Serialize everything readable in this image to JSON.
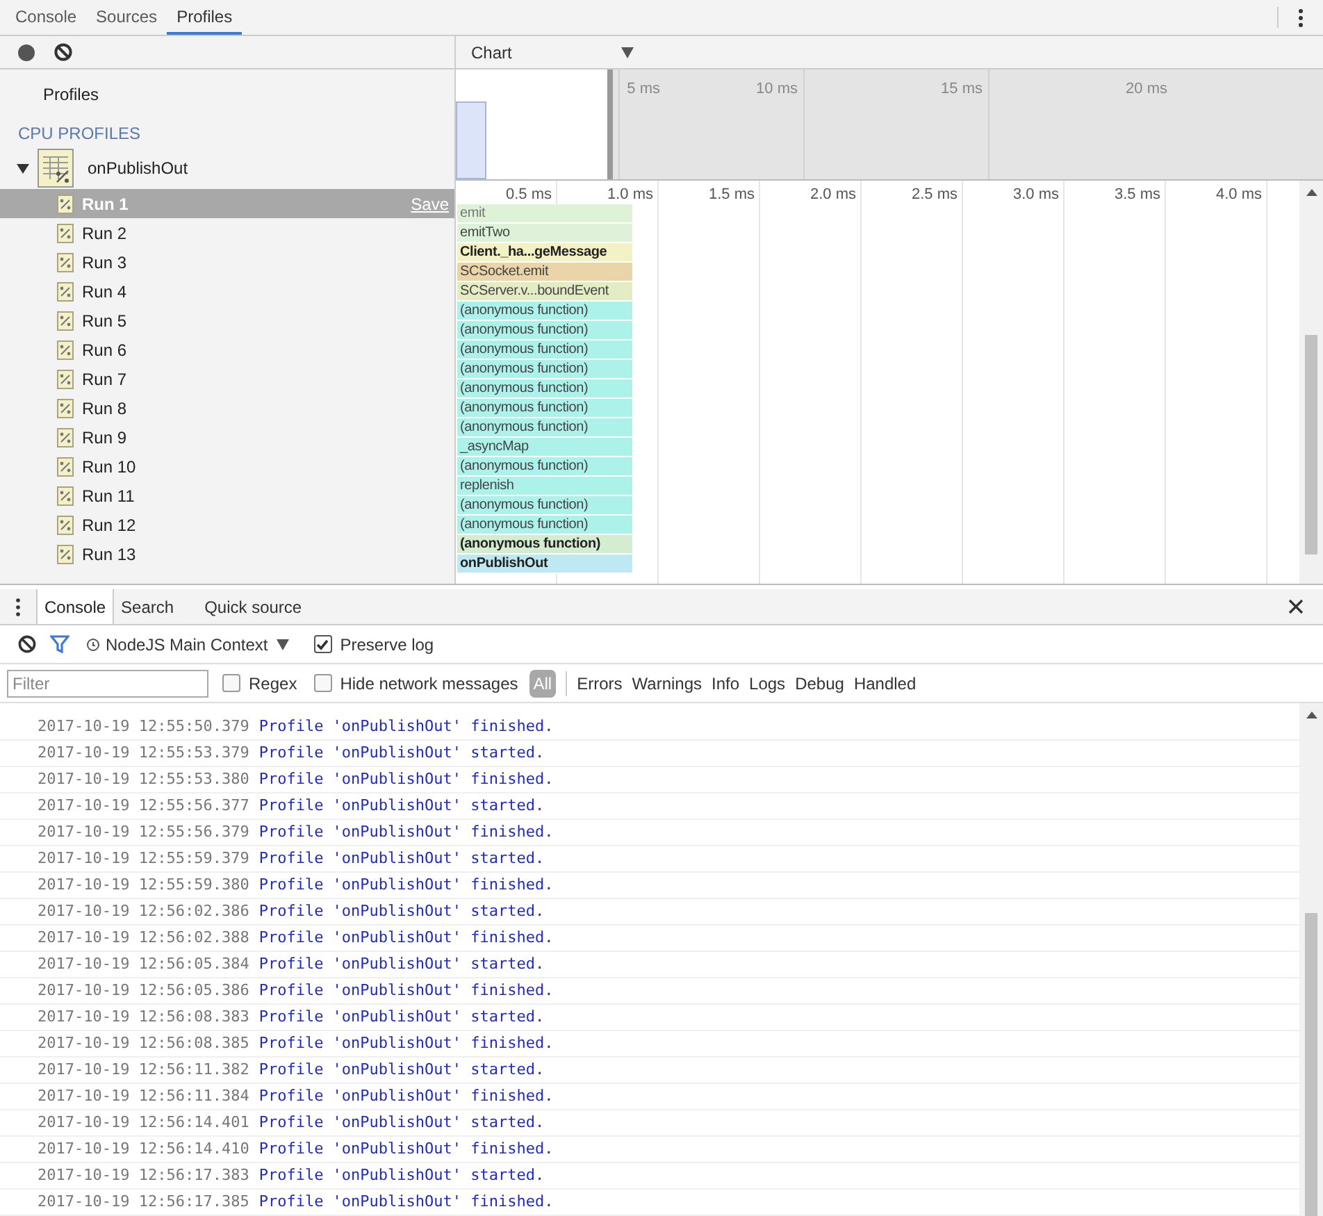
{
  "main_tabs": [
    {
      "label": "Console",
      "selected": false
    },
    {
      "label": "Sources",
      "selected": false
    },
    {
      "label": "Profiles",
      "selected": true
    }
  ],
  "profiles_sidebar": {
    "heading": "Profiles",
    "section": "CPU PROFILES",
    "group": {
      "name": "onPublishOut",
      "expanded": true,
      "children": [
        {
          "label": "Run 1",
          "selected": true,
          "action": "Save"
        },
        {
          "label": "Run 2",
          "selected": false
        },
        {
          "label": "Run 3",
          "selected": false
        },
        {
          "label": "Run 4",
          "selected": false
        },
        {
          "label": "Run 5",
          "selected": false
        },
        {
          "label": "Run 6",
          "selected": false
        },
        {
          "label": "Run 7",
          "selected": false
        },
        {
          "label": "Run 8",
          "selected": false
        },
        {
          "label": "Run 9",
          "selected": false
        },
        {
          "label": "Run 10",
          "selected": false
        },
        {
          "label": "Run 11",
          "selected": false
        },
        {
          "label": "Run 12",
          "selected": false
        },
        {
          "label": "Run 13",
          "selected": false
        }
      ]
    }
  },
  "chart_view": {
    "mode": "Chart",
    "overview_ticks": [
      "5 ms",
      "10 ms",
      "15 ms",
      "20 ms"
    ],
    "ticks": [
      "0.5 ms",
      "1.0 ms",
      "1.5 ms",
      "2.0 ms",
      "2.5 ms",
      "3.0 ms",
      "3.5 ms",
      "4.0 ms"
    ],
    "flame": [
      {
        "label": "emit",
        "color": "#def2d8",
        "bold": false
      },
      {
        "label": "emitTwo",
        "color": "#def2d8",
        "bold": false
      },
      {
        "label": "Client._ha...geMessage",
        "color": "#f2f2c4",
        "bold": true
      },
      {
        "label": "SCSocket.emit",
        "color": "#ead5a8",
        "bold": false
      },
      {
        "label": "SCServer.v...boundEvent",
        "color": "#e4ecc4",
        "bold": false
      },
      {
        "label": "(anonymous function)",
        "color": "#adf2ea",
        "bold": false
      },
      {
        "label": "(anonymous function)",
        "color": "#adf2ea",
        "bold": false
      },
      {
        "label": "(anonymous function)",
        "color": "#adf2ea",
        "bold": false
      },
      {
        "label": "(anonymous function)",
        "color": "#adf2ea",
        "bold": false
      },
      {
        "label": "(anonymous function)",
        "color": "#adf2ea",
        "bold": false
      },
      {
        "label": "(anonymous function)",
        "color": "#adf2ea",
        "bold": false
      },
      {
        "label": "(anonymous function)",
        "color": "#adf2ea",
        "bold": false
      },
      {
        "label": "_asyncMap",
        "color": "#adf2ea",
        "bold": false
      },
      {
        "label": "(anonymous function)",
        "color": "#adf2ea",
        "bold": false
      },
      {
        "label": "replenish",
        "color": "#adf2ea",
        "bold": false
      },
      {
        "label": "(anonymous function)",
        "color": "#adf2ea",
        "bold": false
      },
      {
        "label": "(anonymous function)",
        "color": "#adf2ea",
        "bold": false
      },
      {
        "label": "(anonymous function)",
        "color": "#d4ecd0",
        "bold": true
      },
      {
        "label": "onPublishOut",
        "color": "#bfe9f2",
        "bold": true
      }
    ]
  },
  "drawer": {
    "tabs": [
      {
        "label": "Console",
        "selected": true
      },
      {
        "label": "Search",
        "selected": false
      },
      {
        "label": "Quick source",
        "selected": false
      }
    ],
    "context": "NodeJS Main Context",
    "preserve_log": {
      "label": "Preserve log",
      "checked": true
    },
    "filter": {
      "placeholder": "Filter"
    },
    "regex": {
      "label": "Regex",
      "checked": false
    },
    "hide_network": {
      "label": "Hide network messages",
      "checked": false
    },
    "levels": [
      {
        "label": "All",
        "selected": true
      },
      {
        "label": "Errors",
        "selected": false
      },
      {
        "label": "Warnings",
        "selected": false
      },
      {
        "label": "Info",
        "selected": false
      },
      {
        "label": "Logs",
        "selected": false
      },
      {
        "label": "Debug",
        "selected": false
      },
      {
        "label": "Handled",
        "selected": false
      }
    ],
    "log": [
      {
        "time": "2017-10-19 12:55:50.379",
        "message": "Profile 'onPublishOut' finished."
      },
      {
        "time": "2017-10-19 12:55:53.379",
        "message": "Profile 'onPublishOut' started."
      },
      {
        "time": "2017-10-19 12:55:53.380",
        "message": "Profile 'onPublishOut' finished."
      },
      {
        "time": "2017-10-19 12:55:56.377",
        "message": "Profile 'onPublishOut' started."
      },
      {
        "time": "2017-10-19 12:55:56.379",
        "message": "Profile 'onPublishOut' finished."
      },
      {
        "time": "2017-10-19 12:55:59.379",
        "message": "Profile 'onPublishOut' started."
      },
      {
        "time": "2017-10-19 12:55:59.380",
        "message": "Profile 'onPublishOut' finished."
      },
      {
        "time": "2017-10-19 12:56:02.386",
        "message": "Profile 'onPublishOut' started."
      },
      {
        "time": "2017-10-19 12:56:02.388",
        "message": "Profile 'onPublishOut' finished."
      },
      {
        "time": "2017-10-19 12:56:05.384",
        "message": "Profile 'onPublishOut' started."
      },
      {
        "time": "2017-10-19 12:56:05.386",
        "message": "Profile 'onPublishOut' finished."
      },
      {
        "time": "2017-10-19 12:56:08.383",
        "message": "Profile 'onPublishOut' started."
      },
      {
        "time": "2017-10-19 12:56:08.385",
        "message": "Profile 'onPublishOut' finished."
      },
      {
        "time": "2017-10-19 12:56:11.382",
        "message": "Profile 'onPublishOut' started."
      },
      {
        "time": "2017-10-19 12:56:11.384",
        "message": "Profile 'onPublishOut' finished."
      },
      {
        "time": "2017-10-19 12:56:14.401",
        "message": "Profile 'onPublishOut' started."
      },
      {
        "time": "2017-10-19 12:56:14.410",
        "message": "Profile 'onPublishOut' finished."
      },
      {
        "time": "2017-10-19 12:56:17.383",
        "message": "Profile 'onPublishOut' started."
      },
      {
        "time": "2017-10-19 12:56:17.385",
        "message": "Profile 'onPublishOut' finished."
      }
    ]
  }
}
